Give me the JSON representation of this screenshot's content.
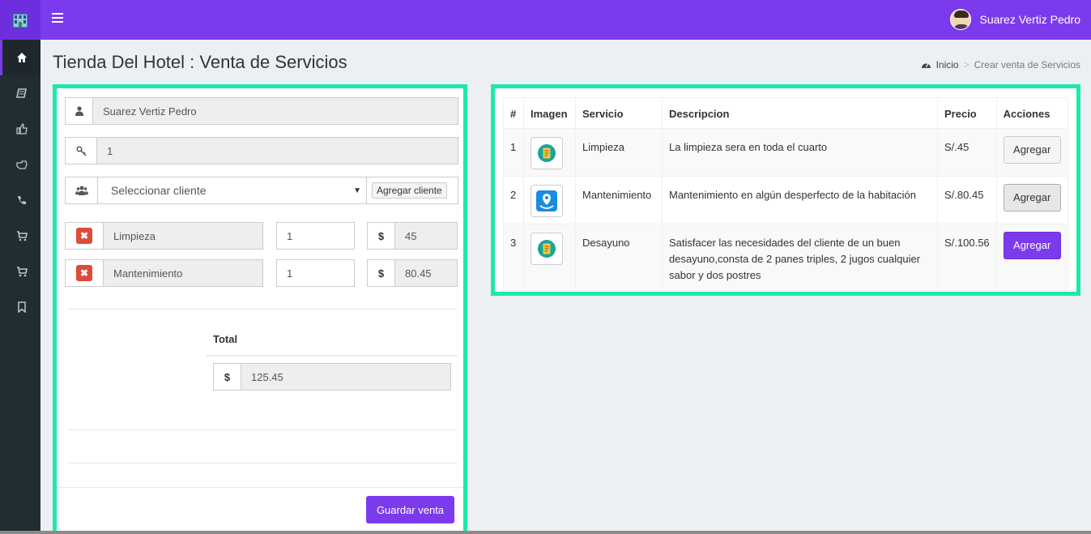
{
  "header": {
    "user_name": "Suarez Vertiz Pedro",
    "brand_color": "#7c3aed"
  },
  "sidebar": {
    "icons": [
      "home-icon",
      "book-icon",
      "thumbs-up-icon",
      "hand-point-icon",
      "phone-icon",
      "cart-icon",
      "cart-icon-2",
      "bookmark-icon"
    ]
  },
  "page": {
    "title": "Tienda Del Hotel : Venta de Servicios"
  },
  "breadcrumb": {
    "home": "Inicio",
    "current": "Crear venta de Servicios",
    "separator": ">"
  },
  "form": {
    "employee": "Suarez Vertiz Pedro",
    "room": "1",
    "client_select": "Seleccionar cliente",
    "add_client_label": "Agregar cliente",
    "currency_symbol": "$",
    "items": [
      {
        "name": "Limpieza",
        "qty": "1",
        "price": "45"
      },
      {
        "name": "Mantenimiento",
        "qty": "1",
        "price": "80.45"
      }
    ],
    "total_label": "Total",
    "total_value": "125.45",
    "save_label": "Guardar venta"
  },
  "table": {
    "headers": [
      "#",
      "Imagen",
      "Servicio",
      "Descripcion",
      "Precio",
      "Acciones"
    ],
    "rows": [
      {
        "num": "1",
        "service": "Limpieza",
        "description": "La limpieza sera en toda el cuarto",
        "price": "S/.45",
        "action": "Agregar",
        "icon": "document-icon"
      },
      {
        "num": "2",
        "service": "Mantenimiento",
        "description": "Mantenimiento en algún desperfecto de la habitación",
        "price": "S/.80.45",
        "action": "Agregar",
        "icon": "map-pin-icon"
      },
      {
        "num": "3",
        "service": "Desayuno",
        "description": "Satisfacer las necesidades del cliente de un buen desayuno,consta de 2 panes triples, 2 jugos cualquier sabor y dos postres",
        "price": "S/.100.56",
        "action": "Agregar",
        "icon": "document-icon"
      }
    ]
  }
}
